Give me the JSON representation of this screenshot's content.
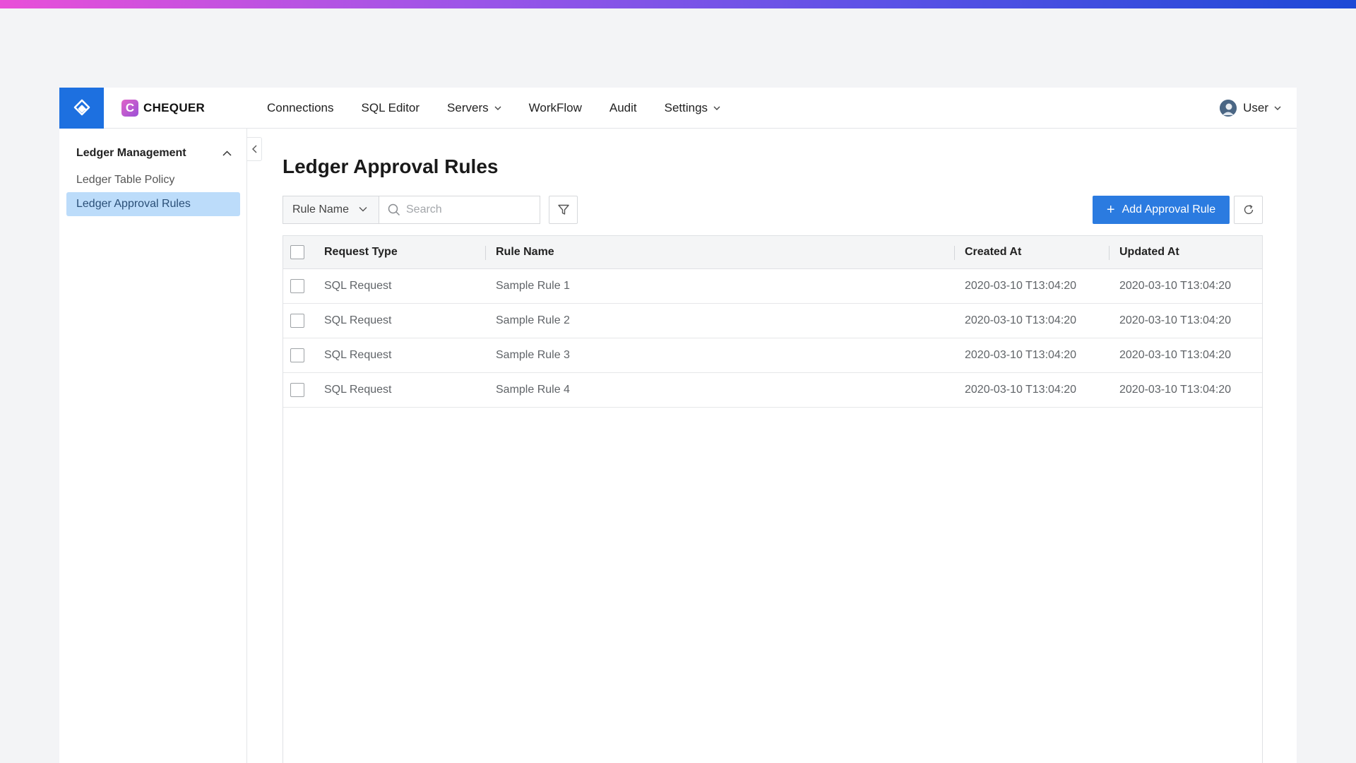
{
  "header": {
    "brand_letter": "C",
    "brand_name": "CHEQUER",
    "nav": [
      {
        "label": "Connections",
        "dropdown": false
      },
      {
        "label": "SQL Editor",
        "dropdown": false
      },
      {
        "label": "Servers",
        "dropdown": true
      },
      {
        "label": "WorkFlow",
        "dropdown": false
      },
      {
        "label": "Audit",
        "dropdown": false
      },
      {
        "label": "Settings",
        "dropdown": true
      }
    ],
    "user_label": "User"
  },
  "sidebar": {
    "group_label": "Ledger Management",
    "items": [
      {
        "label": "Ledger Table Policy",
        "active": false
      },
      {
        "label": "Ledger Approval Rules",
        "active": true
      }
    ]
  },
  "main": {
    "title": "Ledger Approval Rules",
    "toolbar": {
      "select_value": "Rule Name",
      "search_placeholder": "Search",
      "add_label": "Add Approval Rule"
    },
    "table": {
      "columns": [
        "Request Type",
        "Rule Name",
        "Created At",
        "Updated At"
      ],
      "rows": [
        [
          "SQL Request",
          "Sample Rule 1",
          "2020-03-10 T13:04:20",
          "2020-03-10 T13:04:20"
        ],
        [
          "SQL Request",
          "Sample Rule 2",
          "2020-03-10 T13:04:20",
          "2020-03-10 T13:04:20"
        ],
        [
          "SQL Request",
          "Sample Rule 3",
          "2020-03-10 T13:04:20",
          "2020-03-10 T13:04:20"
        ],
        [
          "SQL Request",
          "Sample Rule 4",
          "2020-03-10 T13:04:20",
          "2020-03-10 T13:04:20"
        ]
      ]
    }
  },
  "colors": {
    "primary": "#2b7be0",
    "logo_block": "#1d70e0",
    "active_sidebar": "#bcdcfa"
  }
}
